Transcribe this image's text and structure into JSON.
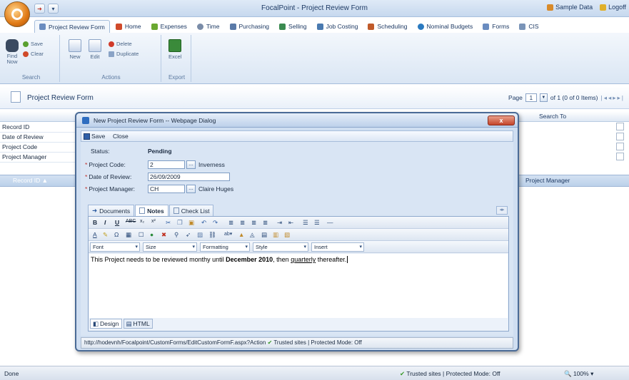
{
  "app": {
    "title": "FocalPoint - Project Review Form",
    "user": "Sample Data",
    "logoff": "Logoff"
  },
  "tabs": [
    {
      "label": "Project Review Form",
      "icon": "form-icon",
      "color": "#6a8cc0"
    },
    {
      "label": "Home",
      "icon": "home-icon",
      "color": "#d04a2a"
    },
    {
      "label": "Expenses",
      "icon": "expenses-icon",
      "color": "#6aa830"
    },
    {
      "label": "Time",
      "icon": "clock-icon",
      "color": "#7a8ca8"
    },
    {
      "label": "Purchasing",
      "icon": "purchasing-icon",
      "color": "#5a7aa8"
    },
    {
      "label": "Selling",
      "icon": "selling-icon",
      "color": "#3a8a50"
    },
    {
      "label": "Job Costing",
      "icon": "job-costing-icon",
      "color": "#4a7ab0"
    },
    {
      "label": "Scheduling",
      "icon": "calendar-icon",
      "color": "#c05a2a"
    },
    {
      "label": "Nominal Budgets",
      "icon": "budget-icon",
      "color": "#2a7ac0"
    },
    {
      "label": "Forms",
      "icon": "forms-icon",
      "color": "#6a8cc0"
    },
    {
      "label": "CIS",
      "icon": "cis-icon",
      "color": "#7a94b8"
    }
  ],
  "ribbon": {
    "search": {
      "label": "Search",
      "find_now": "Find Now",
      "save": "Save",
      "clear": "Clear"
    },
    "actions": {
      "label": "Actions",
      "new": "New",
      "edit": "Edit",
      "delete": "Delete",
      "duplicate": "Duplicate"
    },
    "export": {
      "label": "Export",
      "excel": "Excel"
    }
  },
  "page": {
    "title": "Project Review Form",
    "pager_prefix": "Page",
    "page_number": "1",
    "pager_suffix": "of 1 (0 of 0 Items)"
  },
  "search_grid": {
    "fields": [
      "Record ID",
      "Date of Review",
      "Project Code",
      "Project Manager"
    ],
    "search_to_label": "Search To"
  },
  "results": {
    "columns": [
      "Record ID",
      "Project Manager"
    ]
  },
  "dialog": {
    "title": "New Project Review Form -- Webpage Dialog",
    "close_glyph": "x",
    "toolbar": {
      "save": "Save",
      "close": "Close"
    },
    "status_label": "Status:",
    "status_value": "Pending",
    "fields": {
      "project_code": {
        "label": "Project Code:",
        "value": "2",
        "lookup_text": "Inverness"
      },
      "date_of_review": {
        "label": "Date of Review:",
        "value": "26/09/2009"
      },
      "project_manager": {
        "label": "Project Manager:",
        "value": "CH",
        "lookup_text": "Claire Huges"
      }
    },
    "lookup_button": "...",
    "tabs": [
      "Documents",
      "Notes",
      "Check List"
    ],
    "editor": {
      "dropdowns": [
        "Font",
        "Size",
        "Formatting",
        "Style",
        "Insert"
      ],
      "content_parts": {
        "a": "This Project needs to be reviewed monthy until ",
        "b": "December 2010",
        "c": ", then ",
        "d": "quarterly",
        "e": " thereafter."
      },
      "modes": [
        "Design",
        "HTML"
      ]
    },
    "statusbar": {
      "url": "http://hodevnh/Focalpoint/CustomForms/EditCustomFormF.aspx?Action",
      "zone": "Trusted sites | Protected Mode: Off"
    }
  },
  "browser_status": {
    "left": "Done",
    "zone": "Trusted sites | Protected Mode: Off",
    "zoom": "100%"
  }
}
